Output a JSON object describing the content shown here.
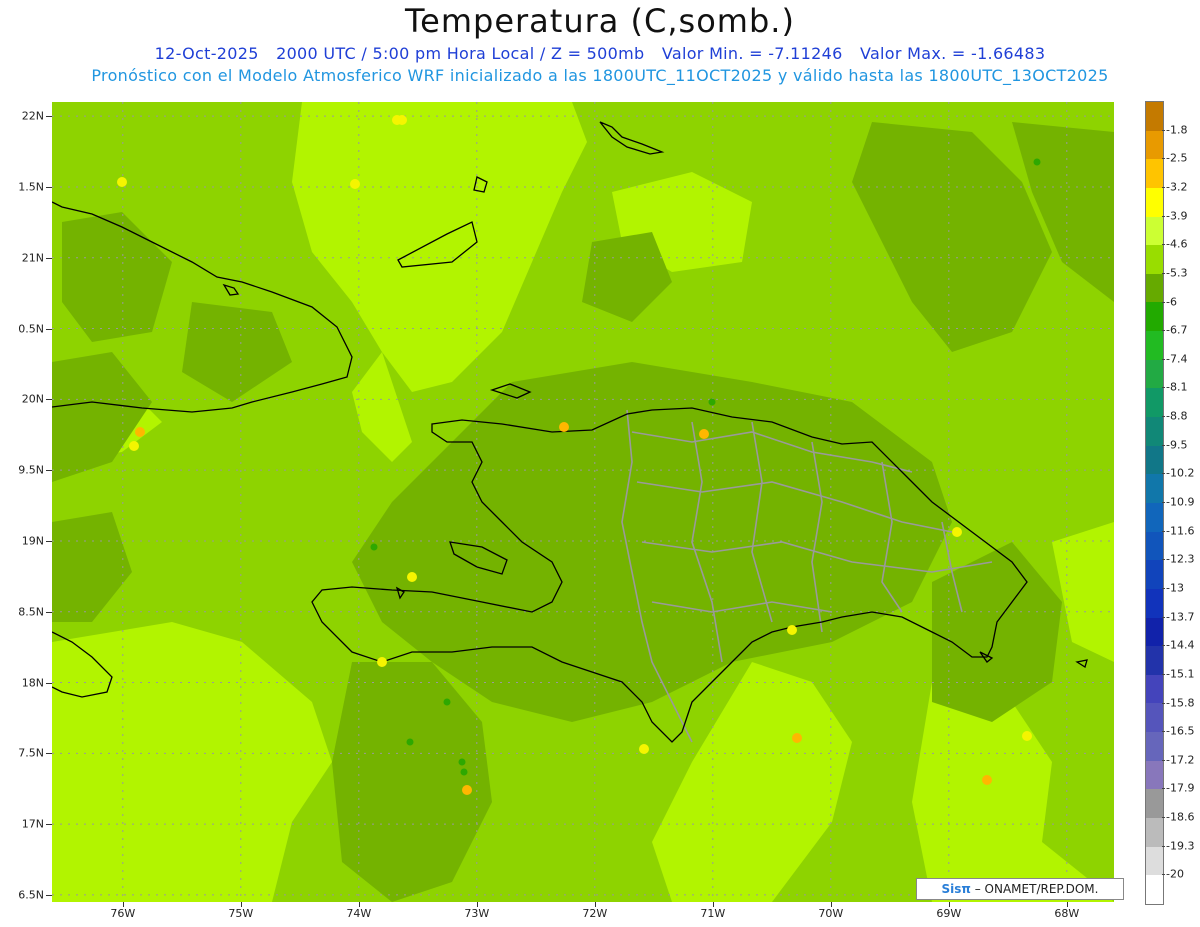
{
  "header": {
    "title": "Temperatura (C,somb.)",
    "date": "12-Oct-2025",
    "time": "2000 UTC / 5:00 pm Hora Local / Z = 500mb",
    "min_value": "Valor Min. = -7.11246",
    "max_value": "Valor Max. = -1.66483",
    "forecast_line": "Pronóstico con el Modelo Atmosferico WRF inicializado a las 1800UTC_11OCT2025 y válido hasta las  1800UTC_13OCT2025"
  },
  "axes": {
    "lon_labels": [
      "76W",
      "75W",
      "74W",
      "73W",
      "72W",
      "71W",
      "70W",
      "69W",
      "68W"
    ],
    "lon_values": [
      -76,
      -75,
      -74,
      -73,
      -72,
      -71,
      -70,
      -69,
      -68
    ],
    "lat_labels": [
      "22N",
      "1.5N",
      "21N",
      "0.5N",
      "20N",
      "9.5N",
      "19N",
      "8.5N",
      "18N",
      "7.5N",
      "17N",
      "6.5N"
    ],
    "lat_values": [
      22,
      21.5,
      21,
      20.5,
      20,
      19.5,
      19,
      18.5,
      18,
      17.5,
      17,
      16.5
    ],
    "lon_range": [
      -76.6,
      -67.6
    ],
    "lat_range": [
      16.45,
      22.1
    ],
    "grid": "dotted"
  },
  "colorbar": {
    "labels": [
      "-1.8",
      "-2.5",
      "-3.2",
      "-3.9",
      "-4.6",
      "-5.3",
      "-6",
      "-6.7",
      "-7.4",
      "-8.1",
      "-8.8",
      "-9.5",
      "-10.2",
      "-10.9",
      "-11.6",
      "-12.3",
      "-13",
      "-13.7",
      "-14.4",
      "-15.1",
      "-15.8",
      "-16.5",
      "-17.2",
      "-17.9",
      "-18.6",
      "-19.3",
      "-20"
    ],
    "colors": [
      "#c47a00",
      "#e89a00",
      "#ffc400",
      "#ffff00",
      "#ccff33",
      "#99dd00",
      "#66aa00",
      "#22aa00",
      "#22bb22",
      "#22aa44",
      "#119966",
      "#118877",
      "#117788",
      "#1177aa",
      "#1166bb",
      "#1155bb",
      "#1144bb",
      "#1133bb",
      "#1122aa",
      "#2233aa",
      "#4444bb",
      "#5555bb",
      "#6666bb",
      "#8877bb",
      "#999999",
      "#bbbbbb",
      "#dddddd",
      "#ffffff"
    ]
  },
  "field_colors": {
    "base": "#8ed300",
    "light": "#b2f400",
    "dark": "#74b300",
    "yellow": "#f5f500",
    "orange": "#ffb700",
    "green": "#2ea800",
    "country_outline": "#000000",
    "province_outline": "#9a9a9a",
    "grid": "#999999"
  },
  "credit": {
    "logo": "Sisπ",
    "text": " – ONAMET/REP.DOM."
  }
}
